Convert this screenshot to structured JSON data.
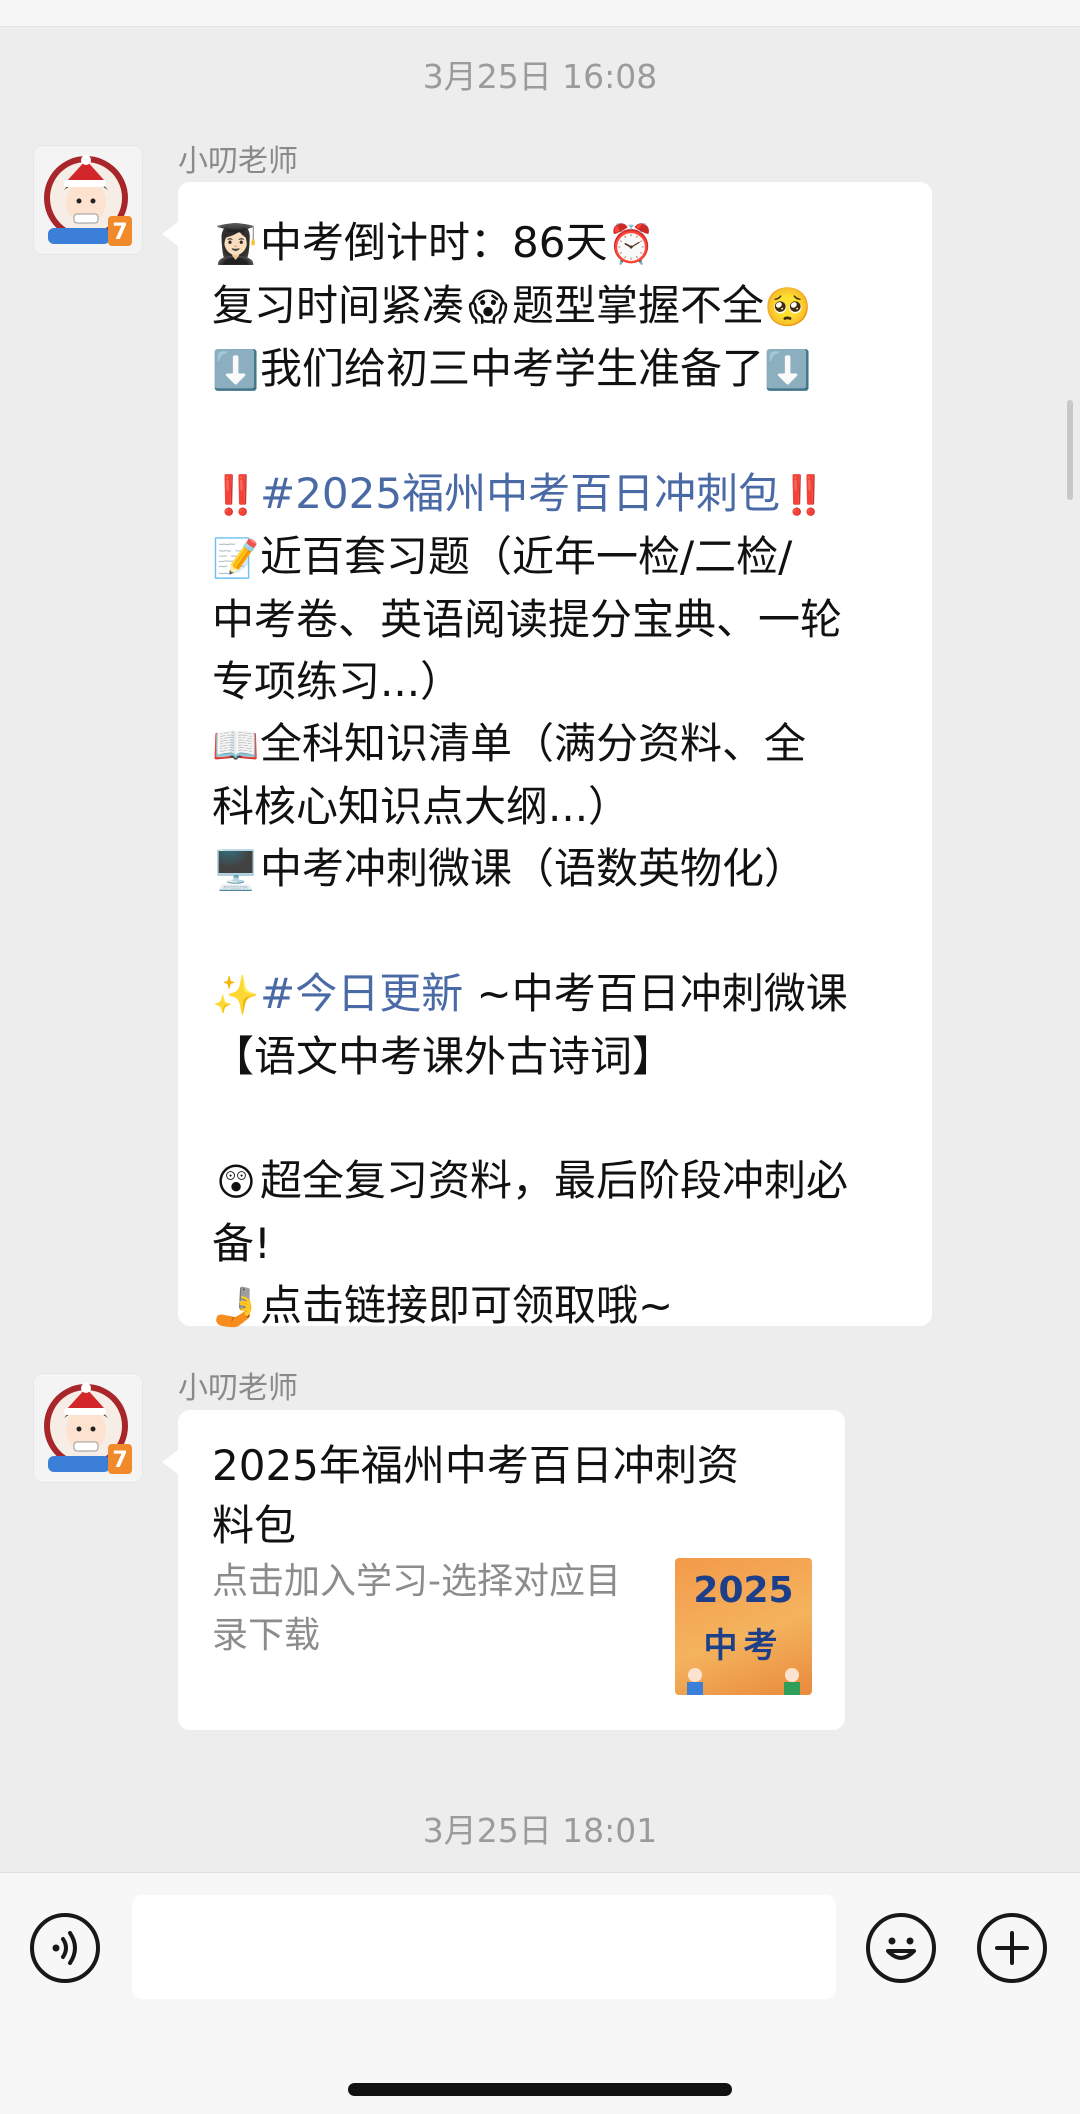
{
  "chat": {
    "timestamp_1": "3月25日 16:08",
    "timestamp_2": "3月25日 18:01",
    "messages": [
      {
        "sender": "小叨老师",
        "lines": [
          {
            "emoji": "👩🏻‍🎓",
            "text": "中考倒计时：86天",
            "emoji_after": "⏰"
          },
          {
            "text": "复习时间紧凑",
            "emoji_mid": "😱",
            "text2": "题型掌握不全",
            "emoji_after": "🥺"
          },
          {
            "emoji": "⬇️",
            "text": "我们给初三中考学生准备了",
            "emoji_after": "⬇️"
          },
          {
            "emoji": "‼️",
            "tag": "#2025福州中考百日冲刺包",
            "emoji_after": "‼️"
          },
          {
            "emoji": "📝",
            "text": "近百套习题（近年一检/二检/"
          },
          {
            "text": "中考卷、英语阅读提分宝典、一轮"
          },
          {
            "text": "专项练习...）"
          },
          {
            "emoji": "📖",
            "text": "全科知识清单（满分资料、全"
          },
          {
            "text": "科核心知识点大纲...）"
          },
          {
            "emoji": "🖥️",
            "text": "中考冲刺微课（语数英物化）"
          },
          {
            "emoji": "✨",
            "tag": "#今日更新",
            "text": " ~中考百日冲刺微课"
          },
          {
            "text": "【语文中考课外古诗词】"
          },
          {
            "emoji": "😲",
            "text": "超全复习资料，最后阶段冲刺必"
          },
          {
            "text": "备!"
          },
          {
            "emoji": "🤳",
            "text": "点击链接即可领取哦~"
          }
        ]
      },
      {
        "sender": "小叨老师",
        "card": {
          "title": "2025年福州中考百日冲刺资料包",
          "description": "点击加入学习-选择对应目录下载",
          "thumb_year": "2025",
          "thumb_word": "中考"
        }
      }
    ]
  },
  "input_bar": {
    "voice_icon": "voice-icon",
    "emoji_icon": "smiley-icon",
    "plus_icon": "plus-icon",
    "placeholder": ""
  },
  "colors": {
    "background": "#ededed",
    "bubble": "#ffffff",
    "hashtag": "#4a6aa6",
    "timestamp": "#9b9b9b"
  }
}
